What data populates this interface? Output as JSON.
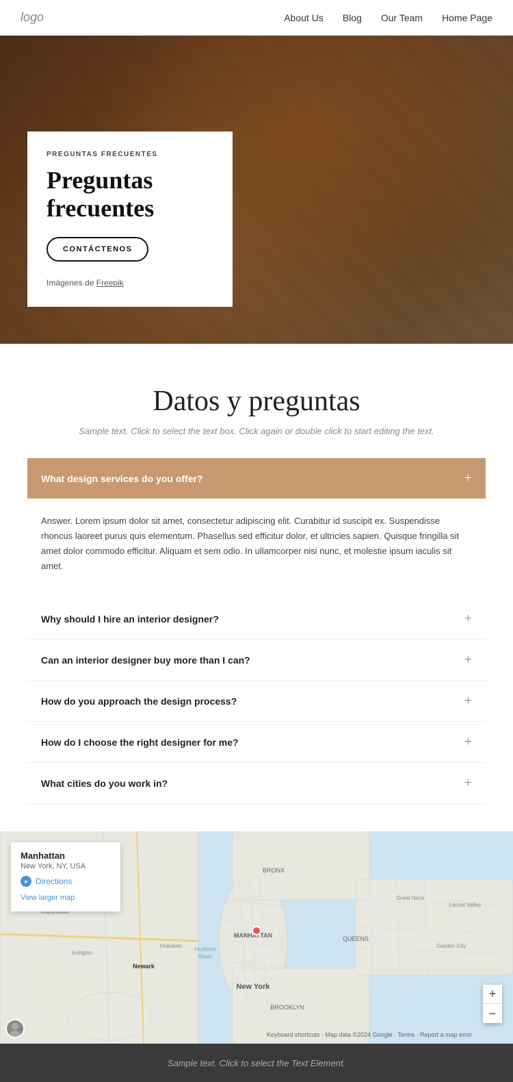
{
  "nav": {
    "logo": "logo",
    "links": [
      {
        "label": "About Us",
        "href": "#"
      },
      {
        "label": "Blog",
        "href": "#"
      },
      {
        "label": "Our Team",
        "href": "#"
      },
      {
        "label": "Home Page",
        "href": "#"
      }
    ]
  },
  "hero": {
    "subtitle": "PREGUNTAS FRECUENTES",
    "title": "Preguntas frecuentes",
    "button_label": "CONTÁCTENOS",
    "credit_text": "Imágenes de ",
    "credit_link": "Freepik"
  },
  "faq_section": {
    "main_title": "Datos y preguntas",
    "subtitle": "Sample text. Click to select the text box. Click again or double click to start editing the text.",
    "active_question": "What design services do you offer?",
    "active_answer": "Answer. Lorem ipsum dolor sit amet, consectetur adipiscing elit. Curabitur id suscipit ex. Suspendisse rhoncus laoreet purus quis elementum. Phasellus sed efficitur dolor, et ultricies sapien. Quisque fringilla sit amet dolor commodo efficitur. Aliquam et sem odio. In ullamcorper nisi nunc, et molestie ipsum iaculis sit amet.",
    "questions": [
      {
        "label": "Why should I hire an interior designer?"
      },
      {
        "label": "Can an interior designer buy more than I can?"
      },
      {
        "label": "How do you approach the design process?"
      },
      {
        "label": "How do I choose the right designer for me?"
      },
      {
        "label": "What cities do you work in?"
      }
    ]
  },
  "map": {
    "city": "Manhattan",
    "address": "New York, NY, USA",
    "directions_label": "Directions",
    "larger_map_label": "View larger map",
    "attribution": "Keyboard shortcuts · Map data ©2024 Google · Terms · Report a map error",
    "zoom_in": "+",
    "zoom_out": "−"
  },
  "footer": {
    "text": "Sample text. Click to select the Text Element."
  }
}
